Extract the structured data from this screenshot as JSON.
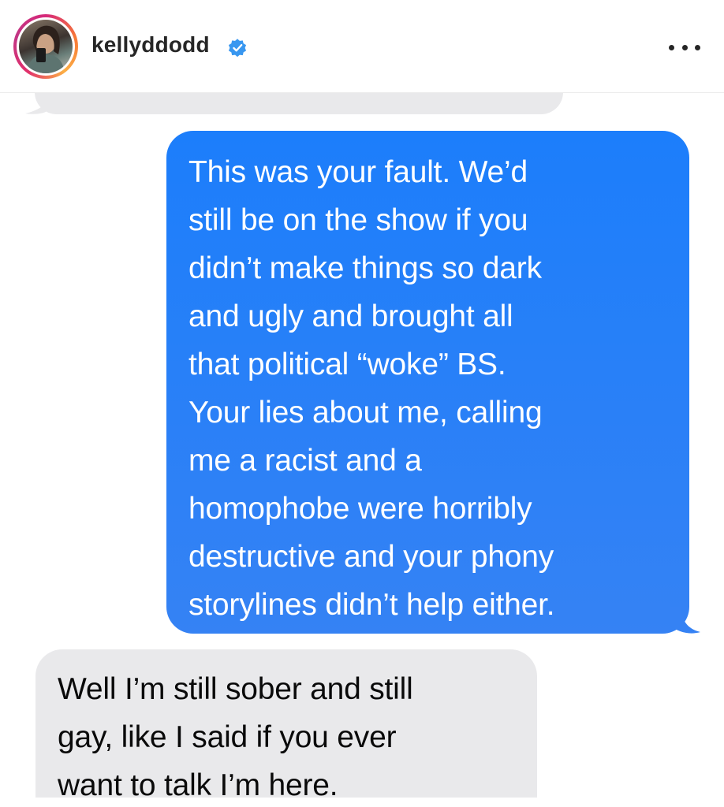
{
  "header": {
    "username": "kellyddodd",
    "verified_color": "#3897f0"
  },
  "messages": [
    {
      "side": "outgoing",
      "text": "This was your fault. We’d\nstill be on the show if you\ndidn’t make things so dark\nand ugly and brought all\nthat political “woke” BS.\nYour lies about me, calling\nme a racist and a\nhomophobe were horribly\ndestructive and your phony\nstorylines didn’t help either."
    },
    {
      "side": "incoming",
      "text": "Well I’m still sober and still\ngay, like I said if you ever\nwant to talk I’m here."
    }
  ],
  "colors": {
    "outgoing_bubble": "#2a80f7",
    "incoming_bubble": "#e9e9eb"
  }
}
